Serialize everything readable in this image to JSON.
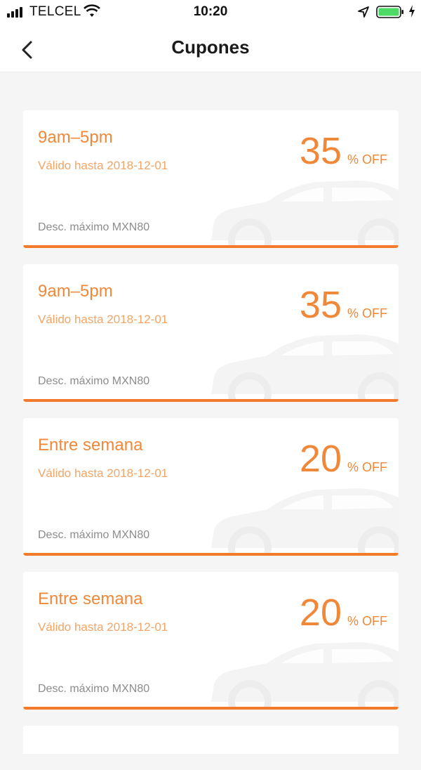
{
  "status_bar": {
    "carrier": "TELCEL",
    "time": "10:20",
    "icons": [
      "signal-icon",
      "wifi-icon",
      "location-arrow-icon",
      "battery-icon",
      "charging-bolt-icon"
    ],
    "battery_color": "#4cd964"
  },
  "nav": {
    "title": "Cupones",
    "back_icon": "chevron-left-icon"
  },
  "colors": {
    "accent": "#f0883a",
    "underline": "#f27a2a",
    "muted": "#8c8c8c",
    "background": "#f5f5f6"
  },
  "coupons": [
    {
      "title": "9am–5pm",
      "validity": "Válido hasta 2018-12-01",
      "discount": "35",
      "off_label": "% OFF",
      "max": "Desc. máximo MXN80"
    },
    {
      "title": "9am–5pm",
      "validity": "Válido hasta 2018-12-01",
      "discount": "35",
      "off_label": "% OFF",
      "max": "Desc. máximo MXN80"
    },
    {
      "title": "Entre semana",
      "validity": "Válido hasta 2018-12-01",
      "discount": "20",
      "off_label": "% OFF",
      "max": "Desc. máximo MXN80"
    },
    {
      "title": "Entre semana",
      "validity": "Válido hasta 2018-12-01",
      "discount": "20",
      "off_label": "% OFF",
      "max": "Desc. máximo MXN80"
    }
  ]
}
